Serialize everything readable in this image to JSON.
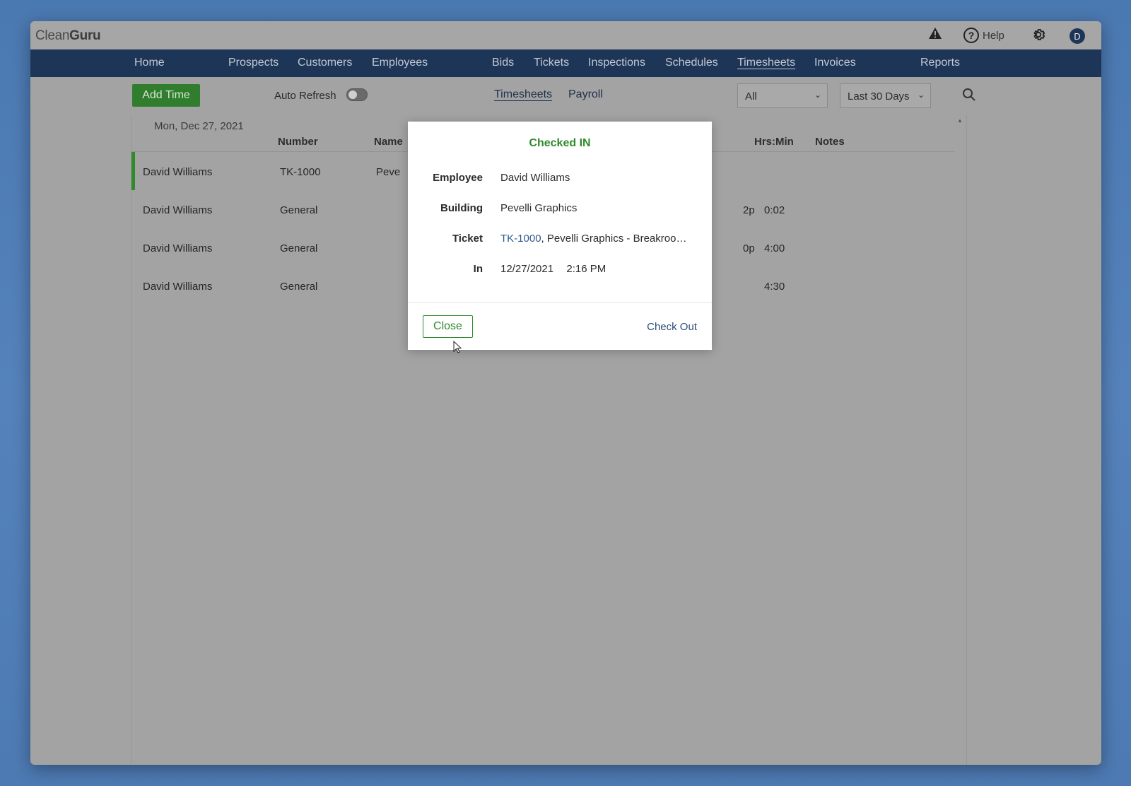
{
  "app": {
    "logo_light": "Clean",
    "logo_bold": "Guru"
  },
  "topbar": {
    "help_label": "Help",
    "avatar_initial": "D",
    "icons": [
      "warning-icon",
      "help-icon",
      "gear-icon"
    ]
  },
  "nav": {
    "items": [
      "Home",
      "Prospects",
      "Customers",
      "Employees",
      "Bids",
      "Tickets",
      "Inspections",
      "Schedules",
      "Timesheets",
      "Invoices",
      "Reports"
    ],
    "active": "Timesheets"
  },
  "toolbar": {
    "add_time_label": "Add Time",
    "auto_refresh_label": "Auto Refresh",
    "auto_refresh_on": false,
    "tabs": [
      "Timesheets",
      "Payroll"
    ],
    "active_tab": "Timesheets",
    "filter_select": "All",
    "range_select": "Last 30 Days"
  },
  "table": {
    "date": "Mon, Dec 27, 2021",
    "headers": {
      "number": "Number",
      "name": "Name",
      "hrs": "Hrs:Min",
      "notes": "Notes"
    },
    "rows": [
      {
        "employee": "David Williams",
        "number": "TK-1000",
        "name_partial": "Peve",
        "time_partial": "",
        "hrs": ""
      },
      {
        "employee": "David Williams",
        "number": "General",
        "name_partial": "",
        "time_partial": "2p",
        "hrs": "0:02"
      },
      {
        "employee": "David Williams",
        "number": "General",
        "name_partial": "",
        "time_partial": "0p",
        "hrs": "4:00"
      },
      {
        "employee": "David Williams",
        "number": "General",
        "name_partial": "",
        "time_partial": "",
        "hrs": "4:30"
      }
    ]
  },
  "modal": {
    "title": "Checked IN",
    "employee_label": "Employee",
    "employee_value": "David Williams",
    "building_label": "Building",
    "building_value": "Pevelli Graphics",
    "ticket_label": "Ticket",
    "ticket_number": "TK-1000",
    "ticket_desc": ", Pevelli Graphics - Breakroo…",
    "in_label": "In",
    "in_date": "12/27/2021",
    "in_time": "2:16 PM",
    "close_label": "Close",
    "checkout_label": "Check Out"
  },
  "colors": {
    "nav_bg": "#1d3557",
    "accent_green": "#2e8a2b",
    "overlay": "#a3a3a3"
  }
}
